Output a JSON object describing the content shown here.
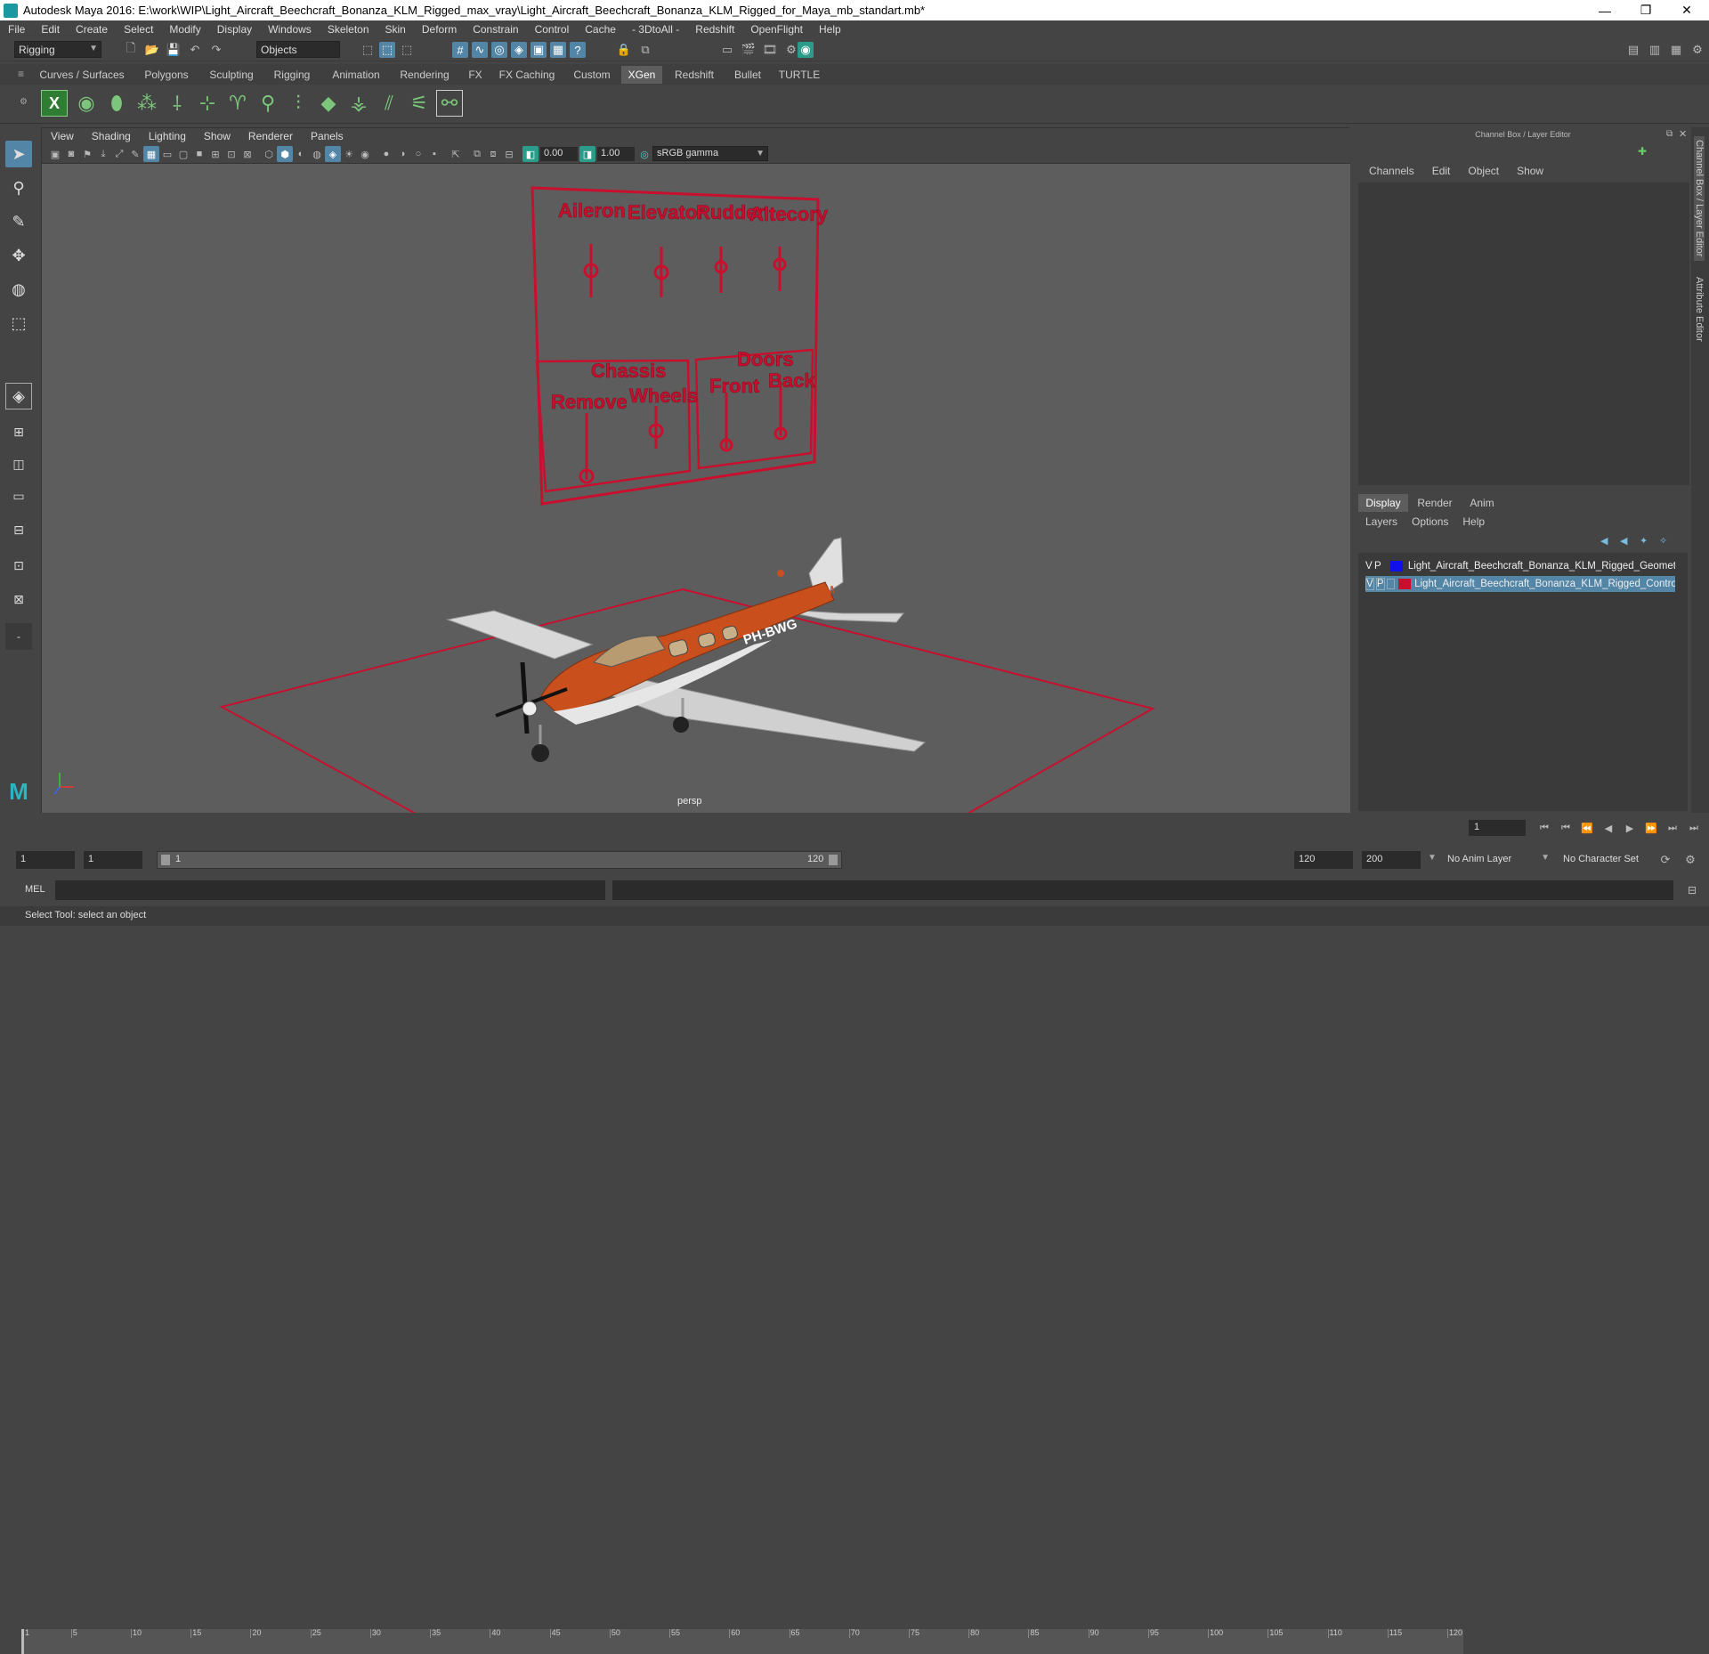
{
  "window": {
    "title": "Autodesk Maya 2016: E:\\work\\WIP\\Light_Aircraft_Beechcraft_Bonanza_KLM_Rigged_max_vray\\Light_Aircraft_Beechcraft_Bonanza_KLM_Rigged_for_Maya_mb_standart.mb*",
    "controls": {
      "minimize": "—",
      "maximize": "❐",
      "close": "✕"
    }
  },
  "menubar": [
    "File",
    "Edit",
    "Create",
    "Select",
    "Modify",
    "Display",
    "Windows",
    "Skeleton",
    "Skin",
    "Deform",
    "Constrain",
    "Control",
    "Cache",
    "- 3DtoAll -",
    "Redshift",
    "OpenFlight",
    "Help"
  ],
  "statusline": {
    "mode": "Rigging",
    "selection_mask": "Objects"
  },
  "shelf": {
    "tabs": [
      "Curves / Surfaces",
      "Polygons",
      "Sculpting",
      "Rigging",
      "Animation",
      "Rendering",
      "FX",
      "FX Caching",
      "Custom",
      "XGen",
      "Redshift",
      "Bullet",
      "TURTLE"
    ],
    "active_tab": "XGen"
  },
  "viewport": {
    "menu": [
      "View",
      "Shading",
      "Lighting",
      "Show",
      "Renderer",
      "Panels"
    ],
    "exposure": "0.00",
    "gamma": "1.00",
    "color_space": "sRGB gamma",
    "camera_label": "persp"
  },
  "scene": {
    "board": {
      "top_labels": [
        "Aileron",
        "Elevator",
        "Rudder",
        "Altecory"
      ],
      "left_group_title": "Chassis",
      "left_labels": [
        "Remove",
        "Wheels"
      ],
      "right_group_title": "Doors",
      "right_labels": [
        "Front",
        "Back"
      ]
    },
    "aircraft": {
      "registration": "PH-BWG",
      "brand": "KLM",
      "body_color": "#c9501d"
    }
  },
  "channel_box": {
    "title": "Channel Box / Layer Editor",
    "menu": [
      "Channels",
      "Edit",
      "Object",
      "Show"
    ]
  },
  "layer_editor": {
    "tabs": [
      "Display",
      "Render",
      "Anim"
    ],
    "active_tab": "Display",
    "menu": [
      "Layers",
      "Options",
      "Help"
    ],
    "layers": [
      {
        "v": "V",
        "p": "P",
        "color": "#1010ee",
        "name": "Light_Aircraft_Beechcraft_Bonanza_KLM_Rigged_Geomet",
        "selected": false
      },
      {
        "v": "V",
        "p": "P",
        "color": "#c8102e",
        "name": "Light_Aircraft_Beechcraft_Bonanza_KLM_Rigged_Controll",
        "selected": true
      }
    ]
  },
  "side_tabs": [
    "Channel Box / Layer Editor",
    "Attribute Editor"
  ],
  "timeline": {
    "ticks": [
      "1",
      "5",
      "10",
      "15",
      "20",
      "25",
      "30",
      "35",
      "40",
      "45",
      "50",
      "55",
      "60",
      "65",
      "70",
      "75",
      "80",
      "85",
      "90",
      "95",
      "100",
      "105",
      "110",
      "115",
      "120"
    ],
    "current_frame": "1"
  },
  "range": {
    "start": "1",
    "playback_start": "1",
    "slider_start": "1",
    "slider_end": "120",
    "playback_end": "120",
    "end": "200",
    "anim_layer": "No Anim Layer",
    "character_set": "No Character Set"
  },
  "command_line": {
    "label": "MEL"
  },
  "help_line": "Select Tool: select an object"
}
